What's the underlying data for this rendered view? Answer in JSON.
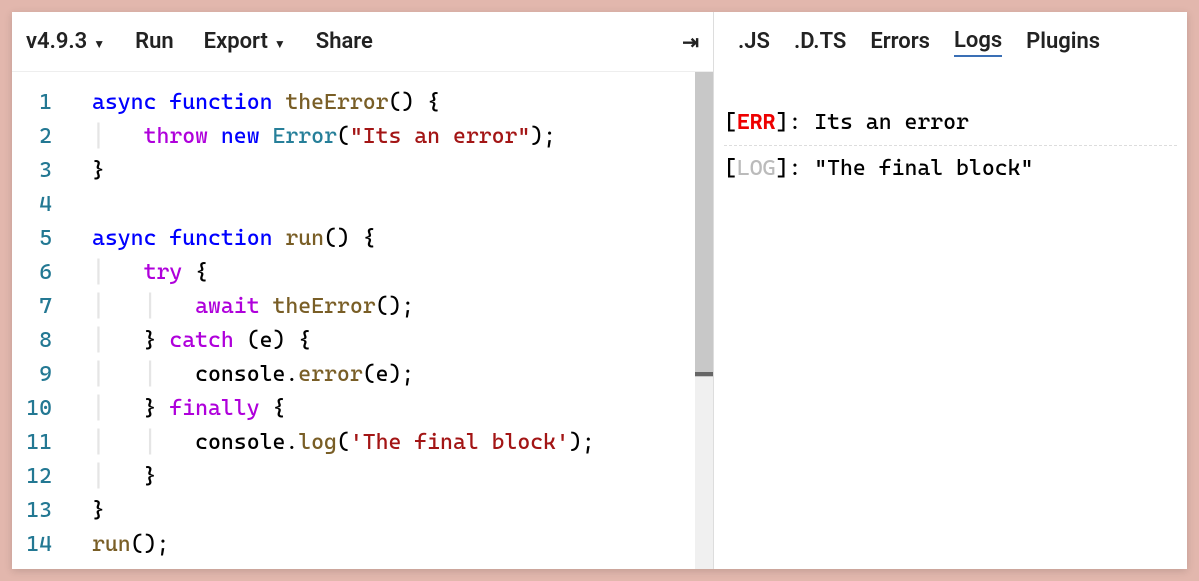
{
  "toolbar": {
    "version": "v4.9.3",
    "run": "Run",
    "export": "Export",
    "share": "Share"
  },
  "editor": {
    "lineCount": 14,
    "code": {
      "l1": {
        "a": "async",
        "b": "function",
        "c": "theError",
        "d": "() {"
      },
      "l2": {
        "a": "throw",
        "b": "new",
        "c": "Error",
        "d": "(",
        "e": "\"Its an error\"",
        "f": ");"
      },
      "l3": "}",
      "l5": {
        "a": "async",
        "b": "function",
        "c": "run",
        "d": "() {"
      },
      "l6": {
        "a": "try",
        "b": " {"
      },
      "l7": {
        "a": "await",
        "b": "theError",
        "c": "();"
      },
      "l8": {
        "a": "} ",
        "b": "catch",
        "c": " (",
        "d": "e",
        "e": ") {"
      },
      "l9": {
        "a": "console.",
        "b": "error",
        "c": "(e);"
      },
      "l10": {
        "a": "} ",
        "b": "finally",
        "c": " {"
      },
      "l11": {
        "a": "console.",
        "b": "log",
        "c": "(",
        "d": "'The final block'",
        "e": ");"
      },
      "l12": "}",
      "l13": "}",
      "l14": {
        "a": "run",
        "b": "();"
      }
    }
  },
  "tabs": {
    "js": ".JS",
    "dts": ".D.TS",
    "errors": "Errors",
    "logs": "Logs",
    "plugins": "Plugins",
    "active": "logs"
  },
  "logs": [
    {
      "level": "ERR",
      "message": "Its an error"
    },
    {
      "level": "LOG",
      "message": "\"The final block\""
    }
  ]
}
